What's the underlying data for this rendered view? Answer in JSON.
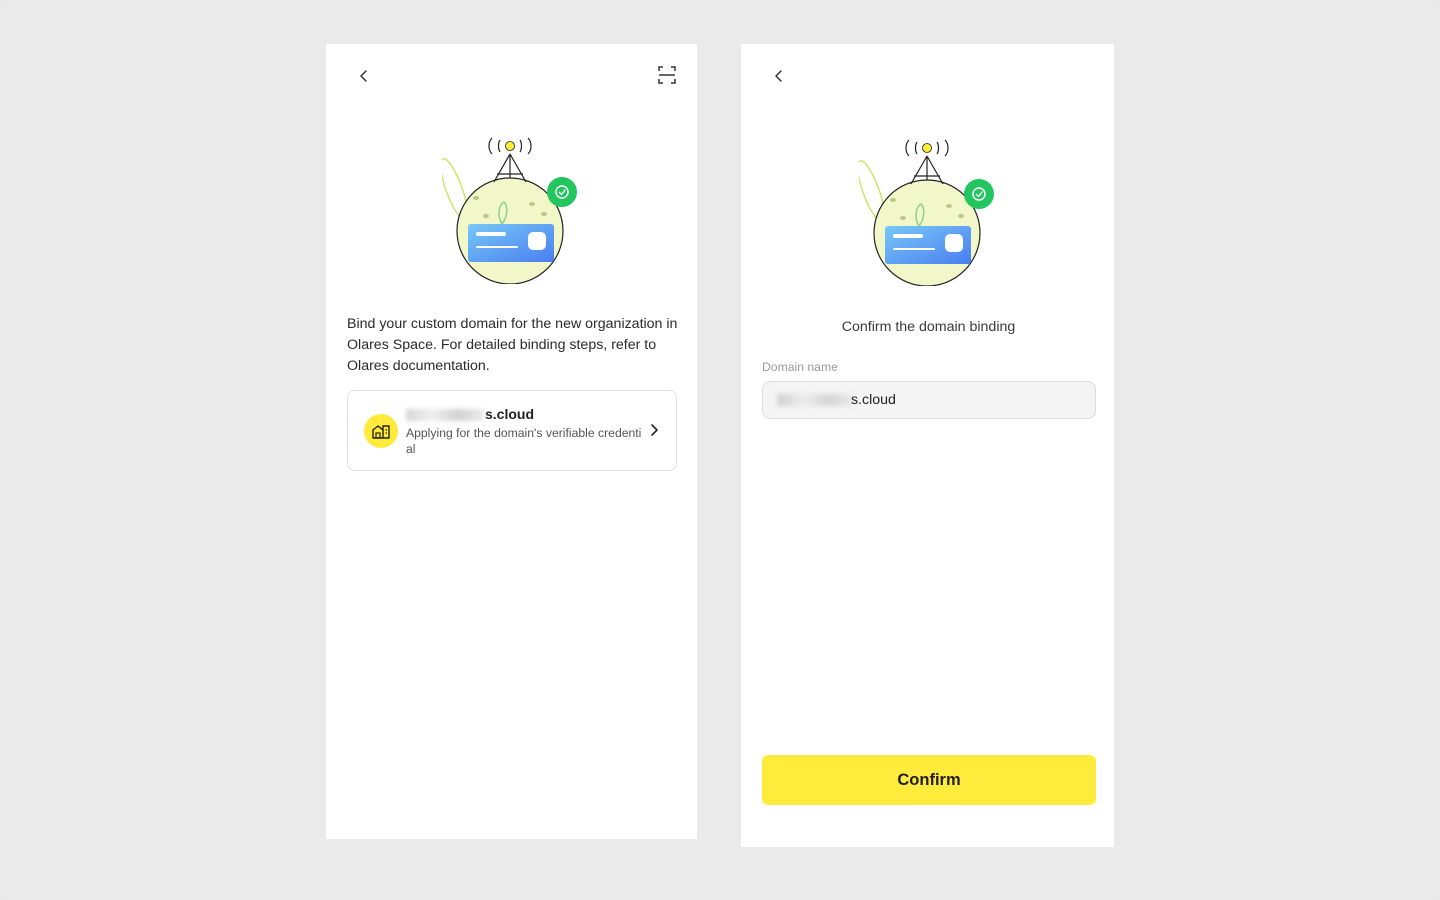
{
  "left_screen": {
    "back_icon": "chevron-left-icon",
    "scan_icon": "scan-icon",
    "intro_text": "Bind your custom domain for the new organization in Olares Space. For detailed binding steps, refer to Olares documentation.",
    "domain_card": {
      "icon": "house-icon",
      "title_suffix": "s.cloud",
      "subtitle": "Applying for the domain's verifiable credential",
      "chevron_icon": "chevron-right-icon"
    }
  },
  "right_screen": {
    "back_icon": "chevron-left-icon",
    "title": "Confirm the domain binding",
    "field_label": "Domain name",
    "domain_value": "s.cloud",
    "confirm_label": "Confirm"
  },
  "colors": {
    "accent": "#ffeb3b",
    "badge_green": "#22c55e",
    "card_blue": "#4f8cf0"
  }
}
